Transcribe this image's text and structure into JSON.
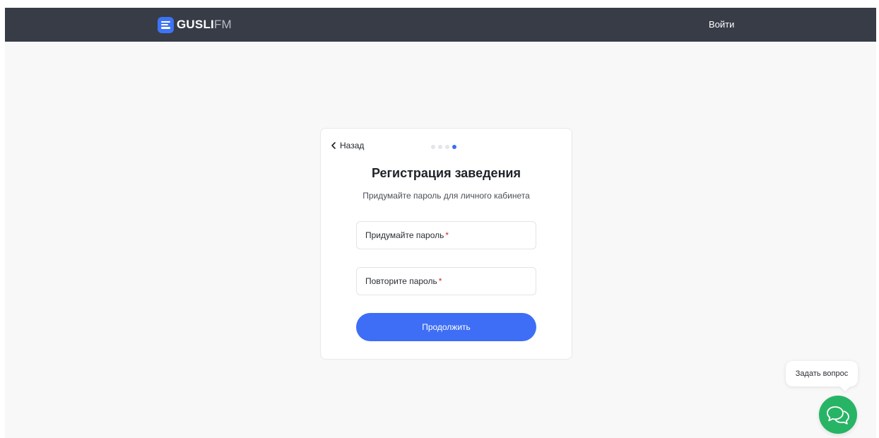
{
  "header": {
    "logo_primary": "GUSLI",
    "logo_secondary": "FM",
    "login_label": "Войти"
  },
  "registration": {
    "back_label": "Назад",
    "steps_total": 4,
    "current_step": 4,
    "title": "Регистрация заведения",
    "subtitle": "Придумайте пароль для личного кабинета",
    "password": {
      "label": "Придумайте пароль",
      "required_mark": "*",
      "value": ""
    },
    "password_repeat": {
      "label": "Повторите пароль",
      "required_mark": "*",
      "value": ""
    },
    "submit_label": "Продолжить"
  },
  "support": {
    "tooltip": "Задать вопрос",
    "icon": "chat-bubbles-icon"
  },
  "colors": {
    "header_bg": "#383c47",
    "accent": "#3d6ef5",
    "required": "#d8262c",
    "support": "#28b465"
  }
}
